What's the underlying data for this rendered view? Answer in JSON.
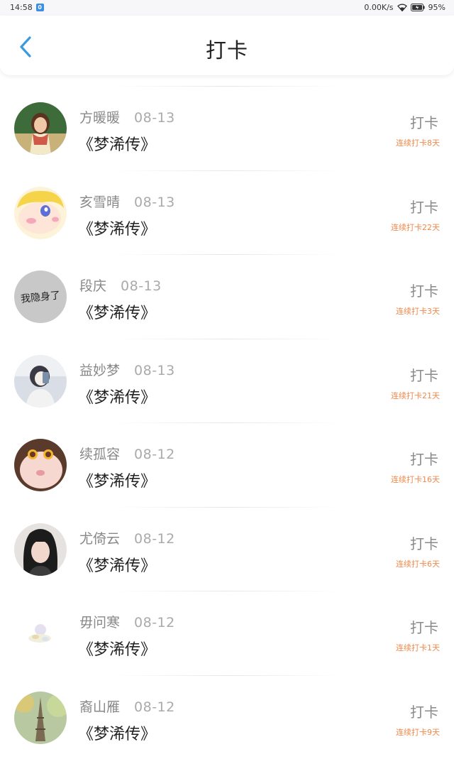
{
  "status_bar": {
    "time": "14:58",
    "app_badge": "0",
    "network_speed": "0.00K/s",
    "battery": "95%",
    "icons": [
      "wifi-icon",
      "battery-icon"
    ]
  },
  "header": {
    "title": "打卡",
    "back_icon": "chevron-left-icon"
  },
  "colors": {
    "accent": "#3a9bdc",
    "streak": "#f0884a",
    "name": "#888888"
  },
  "checkins": [
    {
      "name": "方暖暖",
      "date": "08-13",
      "book": "《梦浠传》",
      "action": "打卡",
      "streak": "连续打卡8天"
    },
    {
      "name": "亥雪晴",
      "date": "08-13",
      "book": "《梦浠传》",
      "action": "打卡",
      "streak": "连续打卡22天"
    },
    {
      "name": "段庆",
      "date": "08-13",
      "book": "《梦浠传》",
      "action": "打卡",
      "streak": "连续打卡3天",
      "avatar_text": "我隐身了"
    },
    {
      "name": "益妙梦",
      "date": "08-13",
      "book": "《梦浠传》",
      "action": "打卡",
      "streak": "连续打卡21天"
    },
    {
      "name": "续孤容",
      "date": "08-12",
      "book": "《梦浠传》",
      "action": "打卡",
      "streak": "连续打卡16天"
    },
    {
      "name": "尤倚云",
      "date": "08-12",
      "book": "《梦浠传》",
      "action": "打卡",
      "streak": "连续打卡6天"
    },
    {
      "name": "毋问寒",
      "date": "08-12",
      "book": "《梦浠传》",
      "action": "打卡",
      "streak": "连续打卡1天"
    },
    {
      "name": "裔山雁",
      "date": "08-12",
      "book": "《梦浠传》",
      "action": "打卡",
      "streak": "连续打卡9天"
    }
  ]
}
